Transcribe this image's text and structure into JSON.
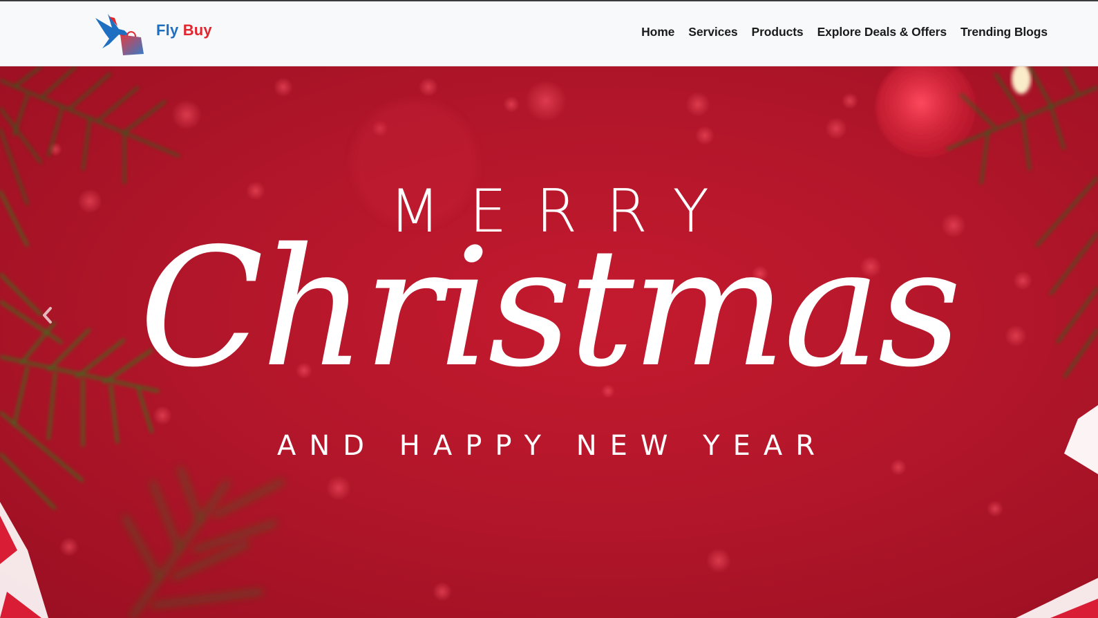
{
  "brand": {
    "name_part1": "Fly",
    "name_part2": "Buy",
    "logo_icon": "bird-shopping-bag-logo",
    "color_primary": "#1e6fc2",
    "color_accent": "#e3262e"
  },
  "nav": {
    "items": [
      {
        "label": "Home"
      },
      {
        "label": "Services"
      },
      {
        "label": "Products"
      },
      {
        "label": "Explore Deals & Offers"
      },
      {
        "label": "Trending Blogs"
      }
    ]
  },
  "hero": {
    "line1": "MERRY",
    "line2": "Christmas",
    "line3": "AND HAPPY NEW YEAR",
    "background_color": "#b3162a",
    "prev_icon": "chevron-left-icon"
  }
}
